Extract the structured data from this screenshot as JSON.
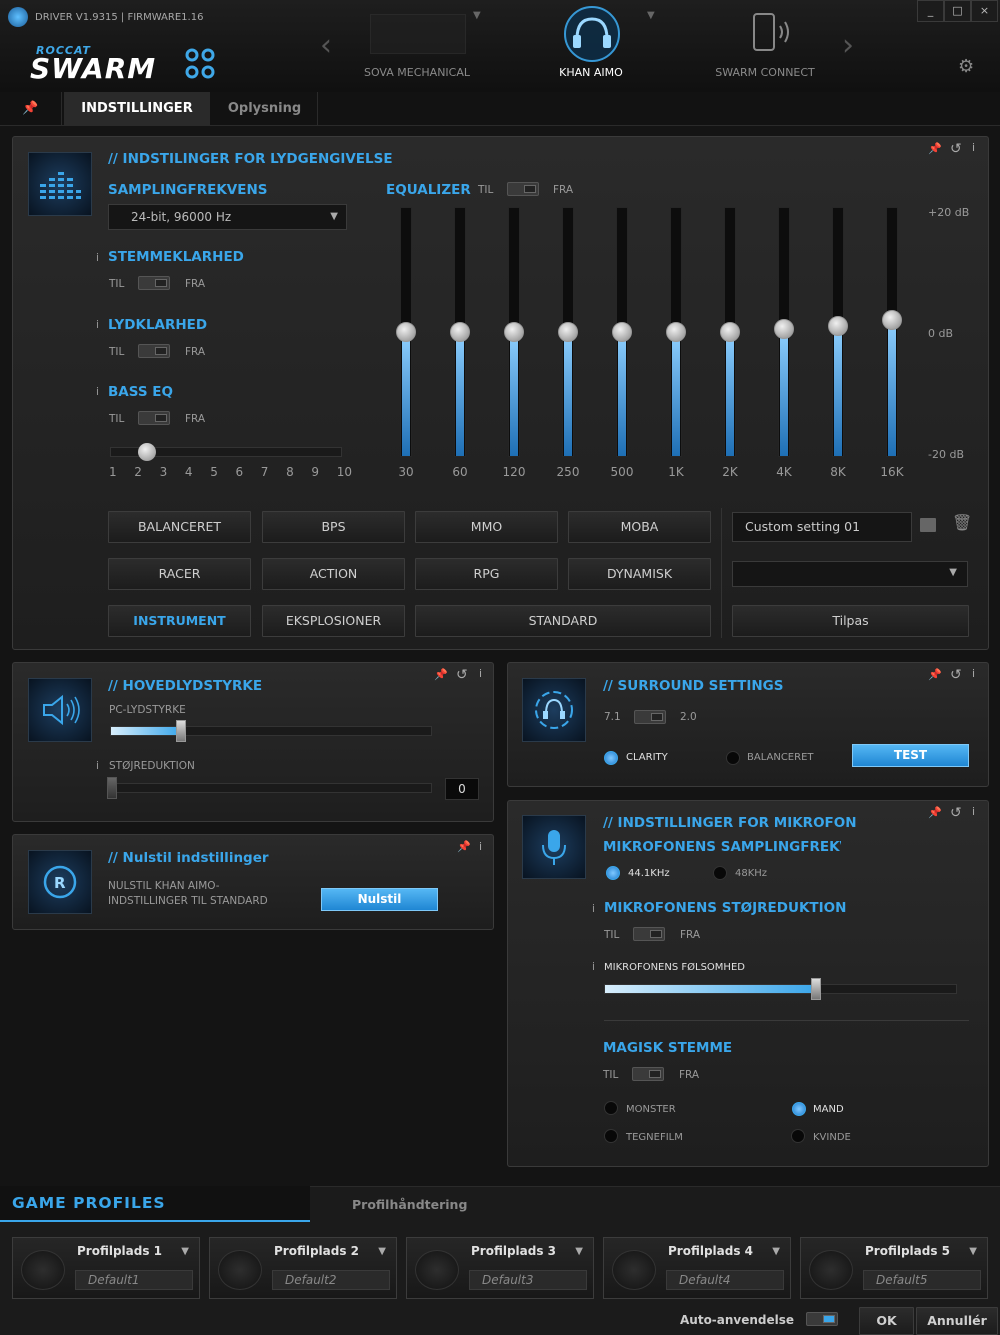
{
  "header": {
    "driver_info": "DRIVER V1.9315 | FIRMWARE1.16",
    "logo_top": "ROCCAT",
    "logo_main": "SWARM",
    "devices": [
      {
        "label": "SOVA MECHANICAL"
      },
      {
        "label": "KHAN AIMO"
      },
      {
        "label": "SWARM CONNECT"
      }
    ],
    "window_buttons": [
      "_",
      "□",
      "×"
    ]
  },
  "tabs": {
    "active": "INDSTILLINGER",
    "other": "Oplysning"
  },
  "playback": {
    "title": "// INDSTILINGER FOR LYDGENGIVELSE",
    "sampling_label": "SAMPLINGFREKVENS",
    "sampling_value": "24-bit, 96000 Hz",
    "voice_clarity": "STEMMEKLARHED",
    "sound_clarity": "LYDKLARHED",
    "bass_eq": "BASS EQ",
    "on": "TIL",
    "off": "FRA",
    "bass_ticks": [
      "1",
      "2",
      "3",
      "4",
      "5",
      "6",
      "7",
      "8",
      "9",
      "10"
    ],
    "bass_level": 2,
    "equalizer_label": "EQUALIZER",
    "eq_bands": [
      {
        "label": "30",
        "db": 0
      },
      {
        "label": "60",
        "db": 0
      },
      {
        "label": "120",
        "db": 0
      },
      {
        "label": "250",
        "db": 0
      },
      {
        "label": "500",
        "db": 0
      },
      {
        "label": "1K",
        "db": 0
      },
      {
        "label": "2K",
        "db": 0
      },
      {
        "label": "4K",
        "db": 0.5
      },
      {
        "label": "8K",
        "db": 1
      },
      {
        "label": "16K",
        "db": 2
      }
    ],
    "db_labels": {
      "top": "+20 dB",
      "mid": "0 dB",
      "bottom": "-20 dB"
    },
    "presets": [
      "BALANCERET",
      "BPS",
      "MMO",
      "MOBA",
      "RACER",
      "ACTION",
      "RPG",
      "DYNAMISK",
      "INSTRUMENT",
      "EKSPLOSIONER",
      "STANDARD"
    ],
    "selected_preset": "INSTRUMENT",
    "custom_setting": "Custom setting 01",
    "customize": "Tilpas"
  },
  "master": {
    "title": "// HOVEDLYDSTYRKE",
    "pc_volume": "PC-LYDSTYRKE",
    "pc_volume_percent": 22,
    "noise_reduction": "STØJREDUKTION",
    "noise_value": "0"
  },
  "reset": {
    "title": "// Nulstil indstillinger",
    "text1": "NULSTIL KHAN AIMO-",
    "text2": "INDSTILLINGER TIL STANDARD",
    "button": "Nulstil"
  },
  "surround": {
    "title": "// SURROUND SETTINGS",
    "left": "7.1",
    "right": "2.0",
    "opt1": "CLARITY",
    "opt2": "BALANCERET",
    "test": "TEST"
  },
  "mic": {
    "title": "// INDSTILLINGER FOR MIKROFON",
    "sampling": "MIKROFONENS SAMPLINGFREKVEI",
    "rate1": "44.1KHz",
    "rate2": "48KHz",
    "noise": "MIKROFONENS STØJREDUKTION",
    "on": "TIL",
    "off": "FRA",
    "sensitivity": "MIKROFONENS FØLSOMHED",
    "sensitivity_percent": 60,
    "magic": "MAGISK STEMME",
    "voices": [
      "MONSTER",
      "MAND",
      "TEGNEFILM",
      "KVINDE"
    ],
    "selected_voice": "MAND"
  },
  "profiles": {
    "tab_active": "GAME PROFILES",
    "tab_other": "Profilhåndtering",
    "slots": [
      {
        "name": "Profilplads 1",
        "value": "Default1"
      },
      {
        "name": "Profilplads 2",
        "value": "Default2"
      },
      {
        "name": "Profilplads 3",
        "value": "Default3"
      },
      {
        "name": "Profilplads 4",
        "value": "Default4"
      },
      {
        "name": "Profilplads 5",
        "value": "Default5"
      }
    ],
    "auto_apply": "Auto-anvendelse",
    "ok": "OK",
    "cancel": "Annullér"
  }
}
